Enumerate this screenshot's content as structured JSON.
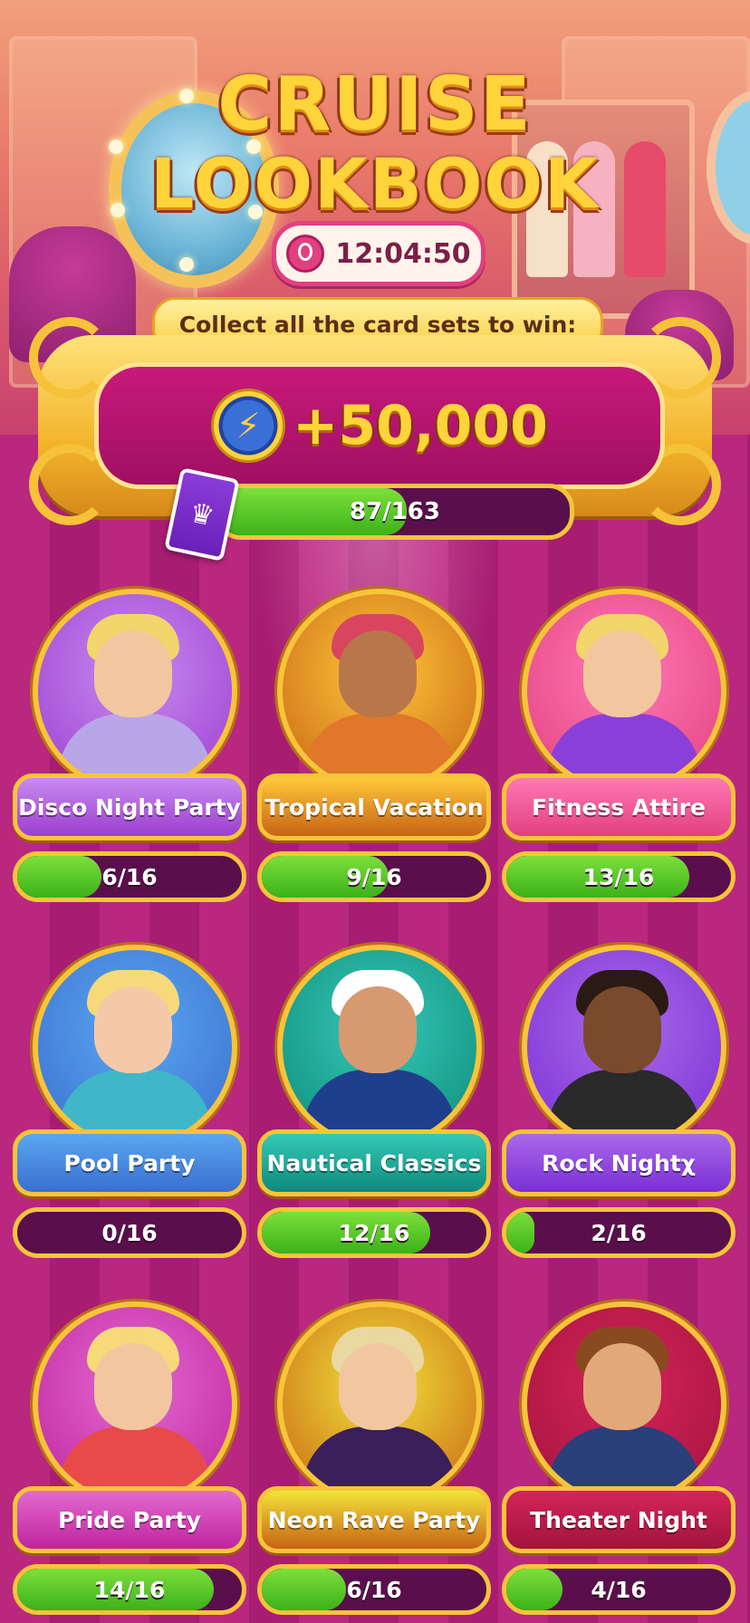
{
  "header": {
    "title_line1": "CRUISE",
    "title_line2": "LOOKBOOK",
    "timer": "12:04:50",
    "collect_text": "Collect all the card sets to win:"
  },
  "reward": {
    "amount": "+50,000",
    "icon": "lightning-coin-icon",
    "progress_text": "87/163",
    "progress_current": 87,
    "progress_total": 163
  },
  "colors": {
    "accent_gold": "#f7c43a",
    "bar_green": "#3bb21a",
    "bar_track": "#5a0f4c",
    "background": "#b3257a"
  },
  "sets": [
    {
      "name": "Disco Night Party",
      "progress": "6/16",
      "current": 6,
      "total": 16,
      "pill": "#9b3fd0",
      "ring": "#c98af0",
      "skin": "#f2c7a0",
      "hair": "#f2d56b",
      "outfit": "#b9a6e8"
    },
    {
      "name": "Tropical Vacation",
      "progress": "9/16",
      "current": 9,
      "total": 16,
      "pill": "#c76314",
      "ring": "#ffc83a",
      "skin": "#b8774a",
      "hair": "#d9455f",
      "outfit": "#e0772a"
    },
    {
      "name": "Fitness Attire",
      "progress": "13/16",
      "current": 13,
      "total": 16,
      "pill": "#e2407f",
      "ring": "#ff79b4",
      "skin": "#f2c7a0",
      "hair": "#f2d56b",
      "outfit": "#8b3fd9"
    },
    {
      "name": "Pool Party",
      "progress": "0/16",
      "current": 0,
      "total": 16,
      "pill": "#3a6fd0",
      "ring": "#5aa6f0",
      "skin": "#f4c9a8",
      "hair": "#f6da7a",
      "outfit": "#3fb7c9"
    },
    {
      "name": "Nautical Classics",
      "progress": "12/16",
      "current": 12,
      "total": 16,
      "pill": "#0f8a7c",
      "ring": "#35c9b6",
      "skin": "#d79a70",
      "hair": "#ffffff",
      "outfit": "#1f3f8c"
    },
    {
      "name": "Rock Nightχ",
      "progress": "2/16",
      "current": 2,
      "total": 16,
      "pill": "#7a2fd6",
      "ring": "#a96ae8",
      "skin": "#7a4a2c",
      "hair": "#2a1a14",
      "outfit": "#2a2a2a"
    },
    {
      "name": "Pride Party",
      "progress": "14/16",
      "current": 14,
      "total": 16,
      "pill": "#c0249e",
      "ring": "#e26ad0",
      "skin": "#f2c7a0",
      "hair": "#f6da7a",
      "outfit": "#e84a4a"
    },
    {
      "name": "Neon Rave Party",
      "progress": "6/16",
      "current": 6,
      "total": 16,
      "pill": "#c76314",
      "ring": "#f2e43a",
      "skin": "#f2c7a0",
      "hair": "#e9d8a0",
      "outfit": "#3a1f5a"
    },
    {
      "name": "Theater Night",
      "progress": "4/16",
      "current": 4,
      "total": 16,
      "pill": "#a3133e",
      "ring": "#d4245a",
      "skin": "#e3a87a",
      "hair": "#8a4a20",
      "outfit": "#2a3f7a"
    }
  ]
}
